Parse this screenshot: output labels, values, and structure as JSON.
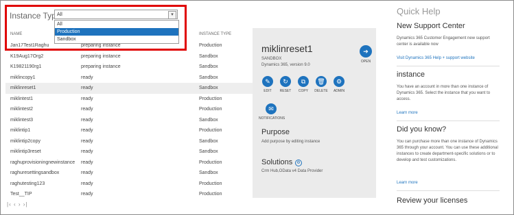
{
  "filter": {
    "label": "Instance Type:",
    "selected": "All",
    "arrow": "▾",
    "options": [
      "All",
      "Production",
      "Sandbox"
    ],
    "highlighted": "Production"
  },
  "columns": {
    "name": "NAME",
    "type": "INSTANCE TYPE"
  },
  "instances": [
    {
      "name": "Jan17Test1Raghu",
      "state": "preparing instance",
      "type": "Production"
    },
    {
      "name": "K19Aug17Org2",
      "state": "preparing instance",
      "type": "Sandbox"
    },
    {
      "name": "K19821190rg1",
      "state": "preparing instance",
      "type": "Sandbox"
    },
    {
      "name": "miklincopy1",
      "state": "ready",
      "type": "Sandbox"
    },
    {
      "name": "miklinreset1",
      "state": "ready",
      "type": "Sandbox"
    },
    {
      "name": "miklintest1",
      "state": "ready",
      "type": "Production"
    },
    {
      "name": "miklintest2",
      "state": "ready",
      "type": "Production"
    },
    {
      "name": "miklintest3",
      "state": "ready",
      "type": "Sandbox"
    },
    {
      "name": "miklintip1",
      "state": "ready",
      "type": "Production"
    },
    {
      "name": "miklintip2copy",
      "state": "ready",
      "type": "Sandbox"
    },
    {
      "name": "miklintip3reset",
      "state": "ready",
      "type": "Sandbox"
    },
    {
      "name": "raghuprovisioningnewinstance",
      "state": "ready",
      "type": "Production"
    },
    {
      "name": "raghuresettingsandbox",
      "state": "ready",
      "type": "Sandbox"
    },
    {
      "name": "raghutesting123",
      "state": "ready",
      "type": "Production"
    },
    {
      "name": "Test__TIP",
      "state": "ready",
      "type": "Production"
    }
  ],
  "pager": "|‹ ‹ › ›|",
  "detail": {
    "title": "miklinreset1",
    "type": "SANDBOX",
    "version": "Dynamics 365, version 9.0",
    "open_label": "OPEN",
    "actions": [
      {
        "label": "EDIT",
        "glyph": "✎"
      },
      {
        "label": "RESET",
        "glyph": "↻"
      },
      {
        "label": "COPY",
        "glyph": "⧉"
      },
      {
        "label": "DELETE",
        "glyph": "🗑"
      },
      {
        "label": "ADMIN",
        "glyph": "⚙"
      }
    ],
    "notifications_label": "NOTIFICATIONS",
    "purpose_heading": "Purpose",
    "purpose_text": "Add purpose by editing instance",
    "solutions_heading": "Solutions",
    "solutions_text": "Crm Hub,OData v4 Data Provider"
  },
  "quick_help": {
    "title": "Quick Help",
    "support_heading": "New Support Center",
    "support_text": "Dynamics 365 Customer Engagement new support center is available now",
    "support_link": "Visit Dynamics 365 Help + support website",
    "instance_heading": "instance",
    "instance_text": "You have an account in more than one instance of Dynamics 365. Select the instance that you want to access.",
    "learn_more_1": "Learn more",
    "know_heading": "Did you know?",
    "know_text": "You can purchase more than one instance of Dynamics 365 through your account. You can use these additional instances to create department-specific solutions or to develop and test customizations.",
    "learn_more_2": "Learn more",
    "licenses_heading": "Review your licenses"
  },
  "colors": {
    "accent": "#1e73be",
    "highlight_box": "#e00000"
  }
}
